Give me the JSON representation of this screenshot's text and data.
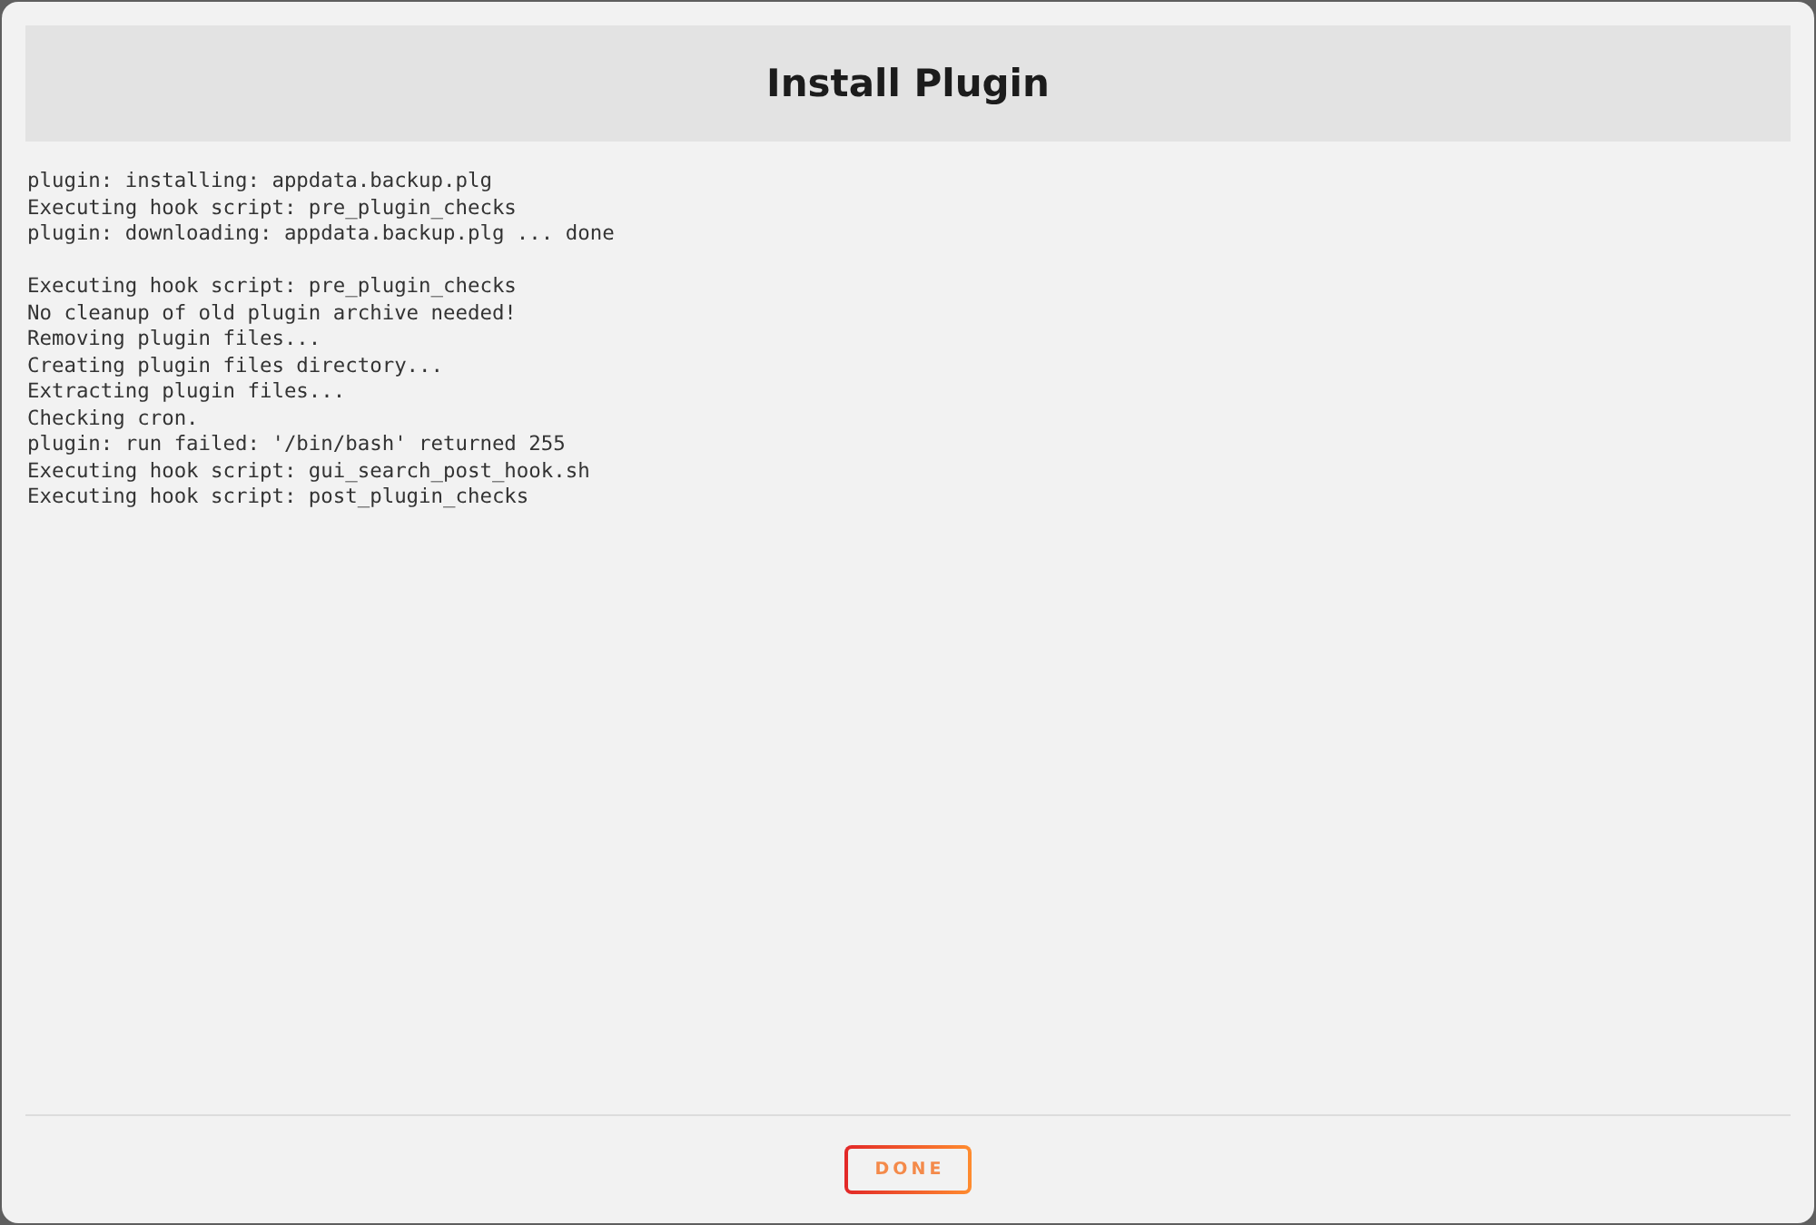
{
  "dialog": {
    "title": "Install Plugin"
  },
  "log": {
    "blocks": [
      [
        "plugin: installing: appdata.backup.plg",
        "Executing hook script: pre_plugin_checks",
        "plugin: downloading: appdata.backup.plg ... done"
      ],
      [
        "Executing hook script: pre_plugin_checks",
        "No cleanup of old plugin archive needed!",
        "Removing plugin files...",
        "Creating plugin files directory...",
        "Extracting plugin files...",
        "Checking cron.",
        "plugin: run failed: '/bin/bash' returned 255",
        "Executing hook script: gui_search_post_hook.sh",
        "Executing hook script: post_plugin_checks"
      ]
    ]
  },
  "buttons": [
    {
      "label": "DONE"
    }
  ]
}
